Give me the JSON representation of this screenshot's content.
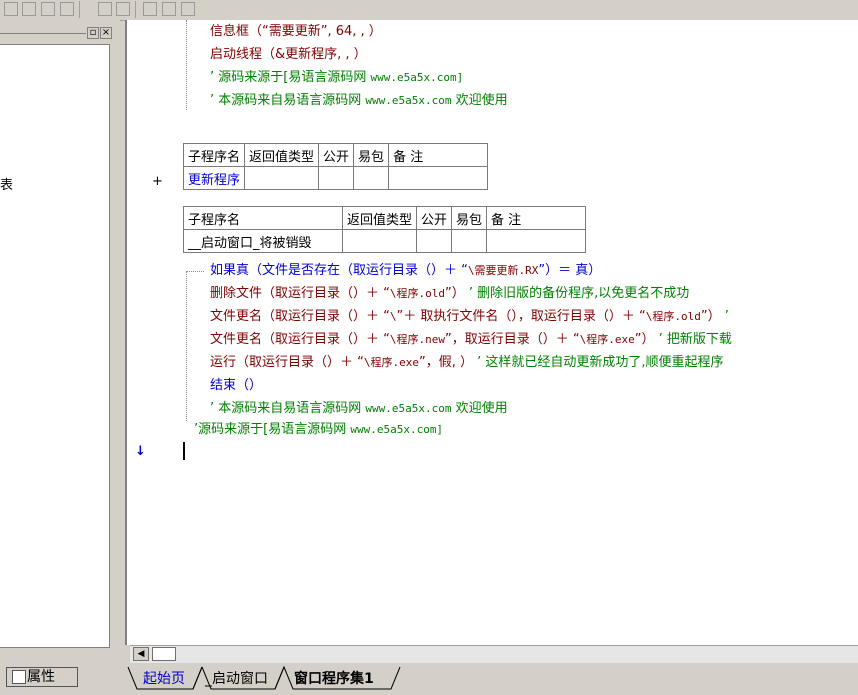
{
  "toolbar": {
    "icons": [
      "align-left-icon",
      "align-center-icon",
      "align-top-icon",
      "align-right-icon",
      "space-h-icon",
      "space-v-icon",
      "size-h-icon",
      "size-v-icon",
      "size-both-icon"
    ]
  },
  "left_panel": {
    "restore_glyph": "▫",
    "close_glyph": "×",
    "cut_text": "表"
  },
  "code": {
    "line1": "信息框（“需要更新”, 64, , ）",
    "line2": "启动线程（&更新程序, , ）",
    "line3_q": "’ 源码来源于[易语言源码网 ",
    "line3_m": "www.e5a5x.com]",
    "line4_q": "’ 本源码来自易语言源码网 ",
    "line4_m": "www.e5a5x.com",
    "line4_e": " 欢迎使用",
    "sub1": {
      "headers": [
        "子程序名",
        "返回值类型",
        "公开",
        "易包",
        "备 注"
      ],
      "name": "更新程序"
    },
    "plus": "+",
    "sub2": {
      "headers": [
        "子程序名",
        "返回值类型",
        "公开",
        "易包",
        "备 注"
      ],
      "name": "__启动窗口_将被销毁"
    },
    "if_a": "如果真（文件是否存在（取运行目录（）＋ “",
    "if_b": "\\需要更新.RX",
    "if_c": "”）＝ 真）",
    "del_a": "删除文件（取运行目录（）＋ “",
    "del_b": "\\程序.old",
    "del_c": "”）",
    "del_d": " ’ 删除旧版的备份程序,以免更名不成功",
    "ren1_a": "文件更名（取运行目录（）＋ “",
    "ren1_b": "\\",
    "ren1_c": "”＋ 取执行文件名（），取运行目录（）＋ “",
    "ren1_d": "\\程序.old",
    "ren1_e": "”）",
    "ren1_f": " ’",
    "ren2_a": "文件更名（取运行目录（）＋ “",
    "ren2_b": "\\程序.new",
    "ren2_c": "”，取运行目录（）＋ “",
    "ren2_d": "\\程序.exe",
    "ren2_e": "”）",
    "ren2_f": " ’ 把新版下载",
    "run_a": "运行（取运行目录（）＋ “",
    "run_b": "\\程序.exe",
    "run_c": "”，假, ）",
    "run_d": " ’ 这样就已经自动更新成功了,顺便重起程序",
    "end": "结束（）",
    "c1_q": "’ 本源码来自易语言源码网 ",
    "c1_m": "www.e5a5x.com",
    "c1_e": " 欢迎使用",
    "c2_q": "’源码来源于[易语言源码网 ",
    "c2_m": "www.e5a5x.com]",
    "arrow": "↓"
  },
  "properties_tab": "属性",
  "tabs": [
    "起始页",
    "_启动窗口",
    "窗口程序集1"
  ]
}
